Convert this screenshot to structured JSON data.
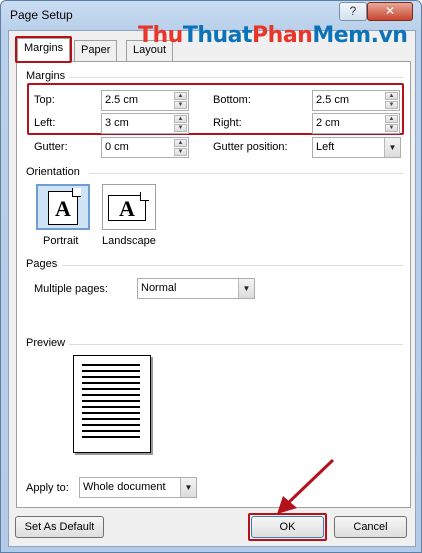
{
  "window": {
    "title": "Page Setup",
    "help_symbol": "?",
    "close_symbol": "✕"
  },
  "watermark": {
    "part1": "Thu",
    "part2": "Thuat",
    "part3": "Phan",
    "part4": "Mem.vn"
  },
  "tabs": [
    {
      "label": "Margins",
      "active": true
    },
    {
      "label": "Paper",
      "active": false
    },
    {
      "label": "Layout",
      "active": false
    }
  ],
  "margins": {
    "heading": "Margins",
    "top": {
      "label": "Top:",
      "value": "2.5 cm"
    },
    "bottom": {
      "label": "Bottom:",
      "value": "2.5 cm"
    },
    "left": {
      "label": "Left:",
      "value": "3 cm"
    },
    "right": {
      "label": "Right:",
      "value": "2 cm"
    },
    "gutter": {
      "label": "Gutter:",
      "value": "0 cm"
    },
    "gutter_position": {
      "label": "Gutter position:",
      "value": "Left"
    }
  },
  "orientation": {
    "heading": "Orientation",
    "portrait": {
      "label": "Portrait",
      "glyph": "A",
      "selected": true
    },
    "landscape": {
      "label": "Landscape",
      "glyph": "A",
      "selected": false
    }
  },
  "pages": {
    "heading": "Pages",
    "multiple_label": "Multiple pages:",
    "multiple_value": "Normal"
  },
  "preview": {
    "heading": "Preview",
    "apply_label": "Apply to:",
    "apply_value": "Whole document"
  },
  "buttons": {
    "set_default": "Set As Default",
    "ok": "OK",
    "cancel": "Cancel"
  },
  "colors": {
    "highlight": "#b3121b",
    "selected_tile": "#cfe3f7"
  }
}
